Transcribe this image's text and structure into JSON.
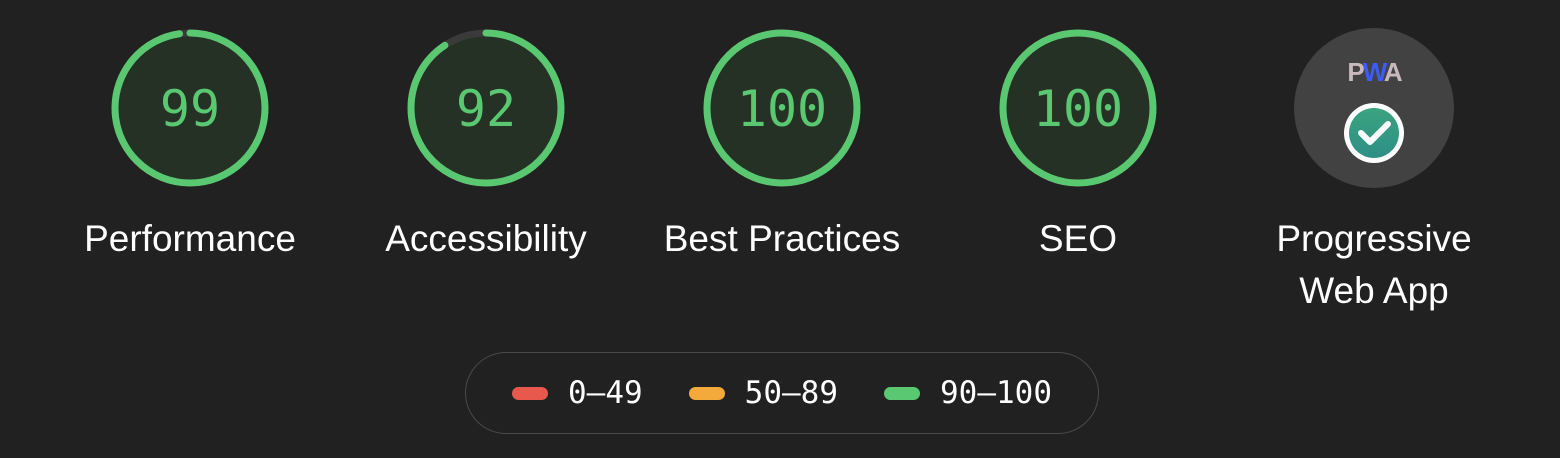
{
  "colors": {
    "pass": "#5ac870",
    "average": "#f4a93b",
    "fail": "#e8584c",
    "pass_fill": "#263126",
    "track": "#3a3a3a",
    "pwa_bg": "#424242"
  },
  "gauges": [
    {
      "label": "Performance",
      "score": "99",
      "fraction": 0.99
    },
    {
      "label": "Accessibility",
      "score": "92",
      "fraction": 0.92
    },
    {
      "label": "Best Practices",
      "score": "100",
      "fraction": 1.0
    },
    {
      "label": "SEO",
      "score": "100",
      "fraction": 1.0
    }
  ],
  "pwa": {
    "logo_text": "PWA",
    "label_line1": "Progressive",
    "label_line2": "Web App",
    "badge_icon": "checkmark-icon"
  },
  "legend": [
    {
      "range": "0–49",
      "status": "fail"
    },
    {
      "range": "50–89",
      "status": "average"
    },
    {
      "range": "90–100",
      "status": "pass"
    }
  ]
}
